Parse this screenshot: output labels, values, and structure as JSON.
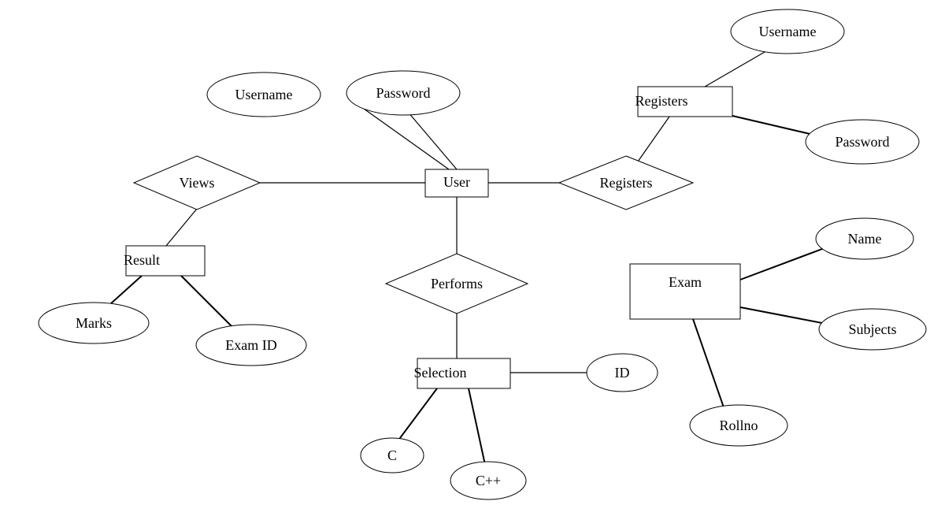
{
  "entities": {
    "user": "User",
    "result": "Result",
    "selection": "Selection",
    "exam": "Exam",
    "registers_entity": "Registers"
  },
  "relationships": {
    "views": "Views",
    "performs": "Performs",
    "registers": "Registers"
  },
  "attributes": {
    "user_username": "Username",
    "user_password": "Password",
    "result_marks": "Marks",
    "result_examid": "Exam ID",
    "selection_id": "ID",
    "selection_c": "C",
    "selection_cpp": "C++",
    "exam_name": "Name",
    "exam_subjects": "Subjects",
    "exam_rollno": "Rollno",
    "registers_username": "Username",
    "registers_password": "Password"
  }
}
